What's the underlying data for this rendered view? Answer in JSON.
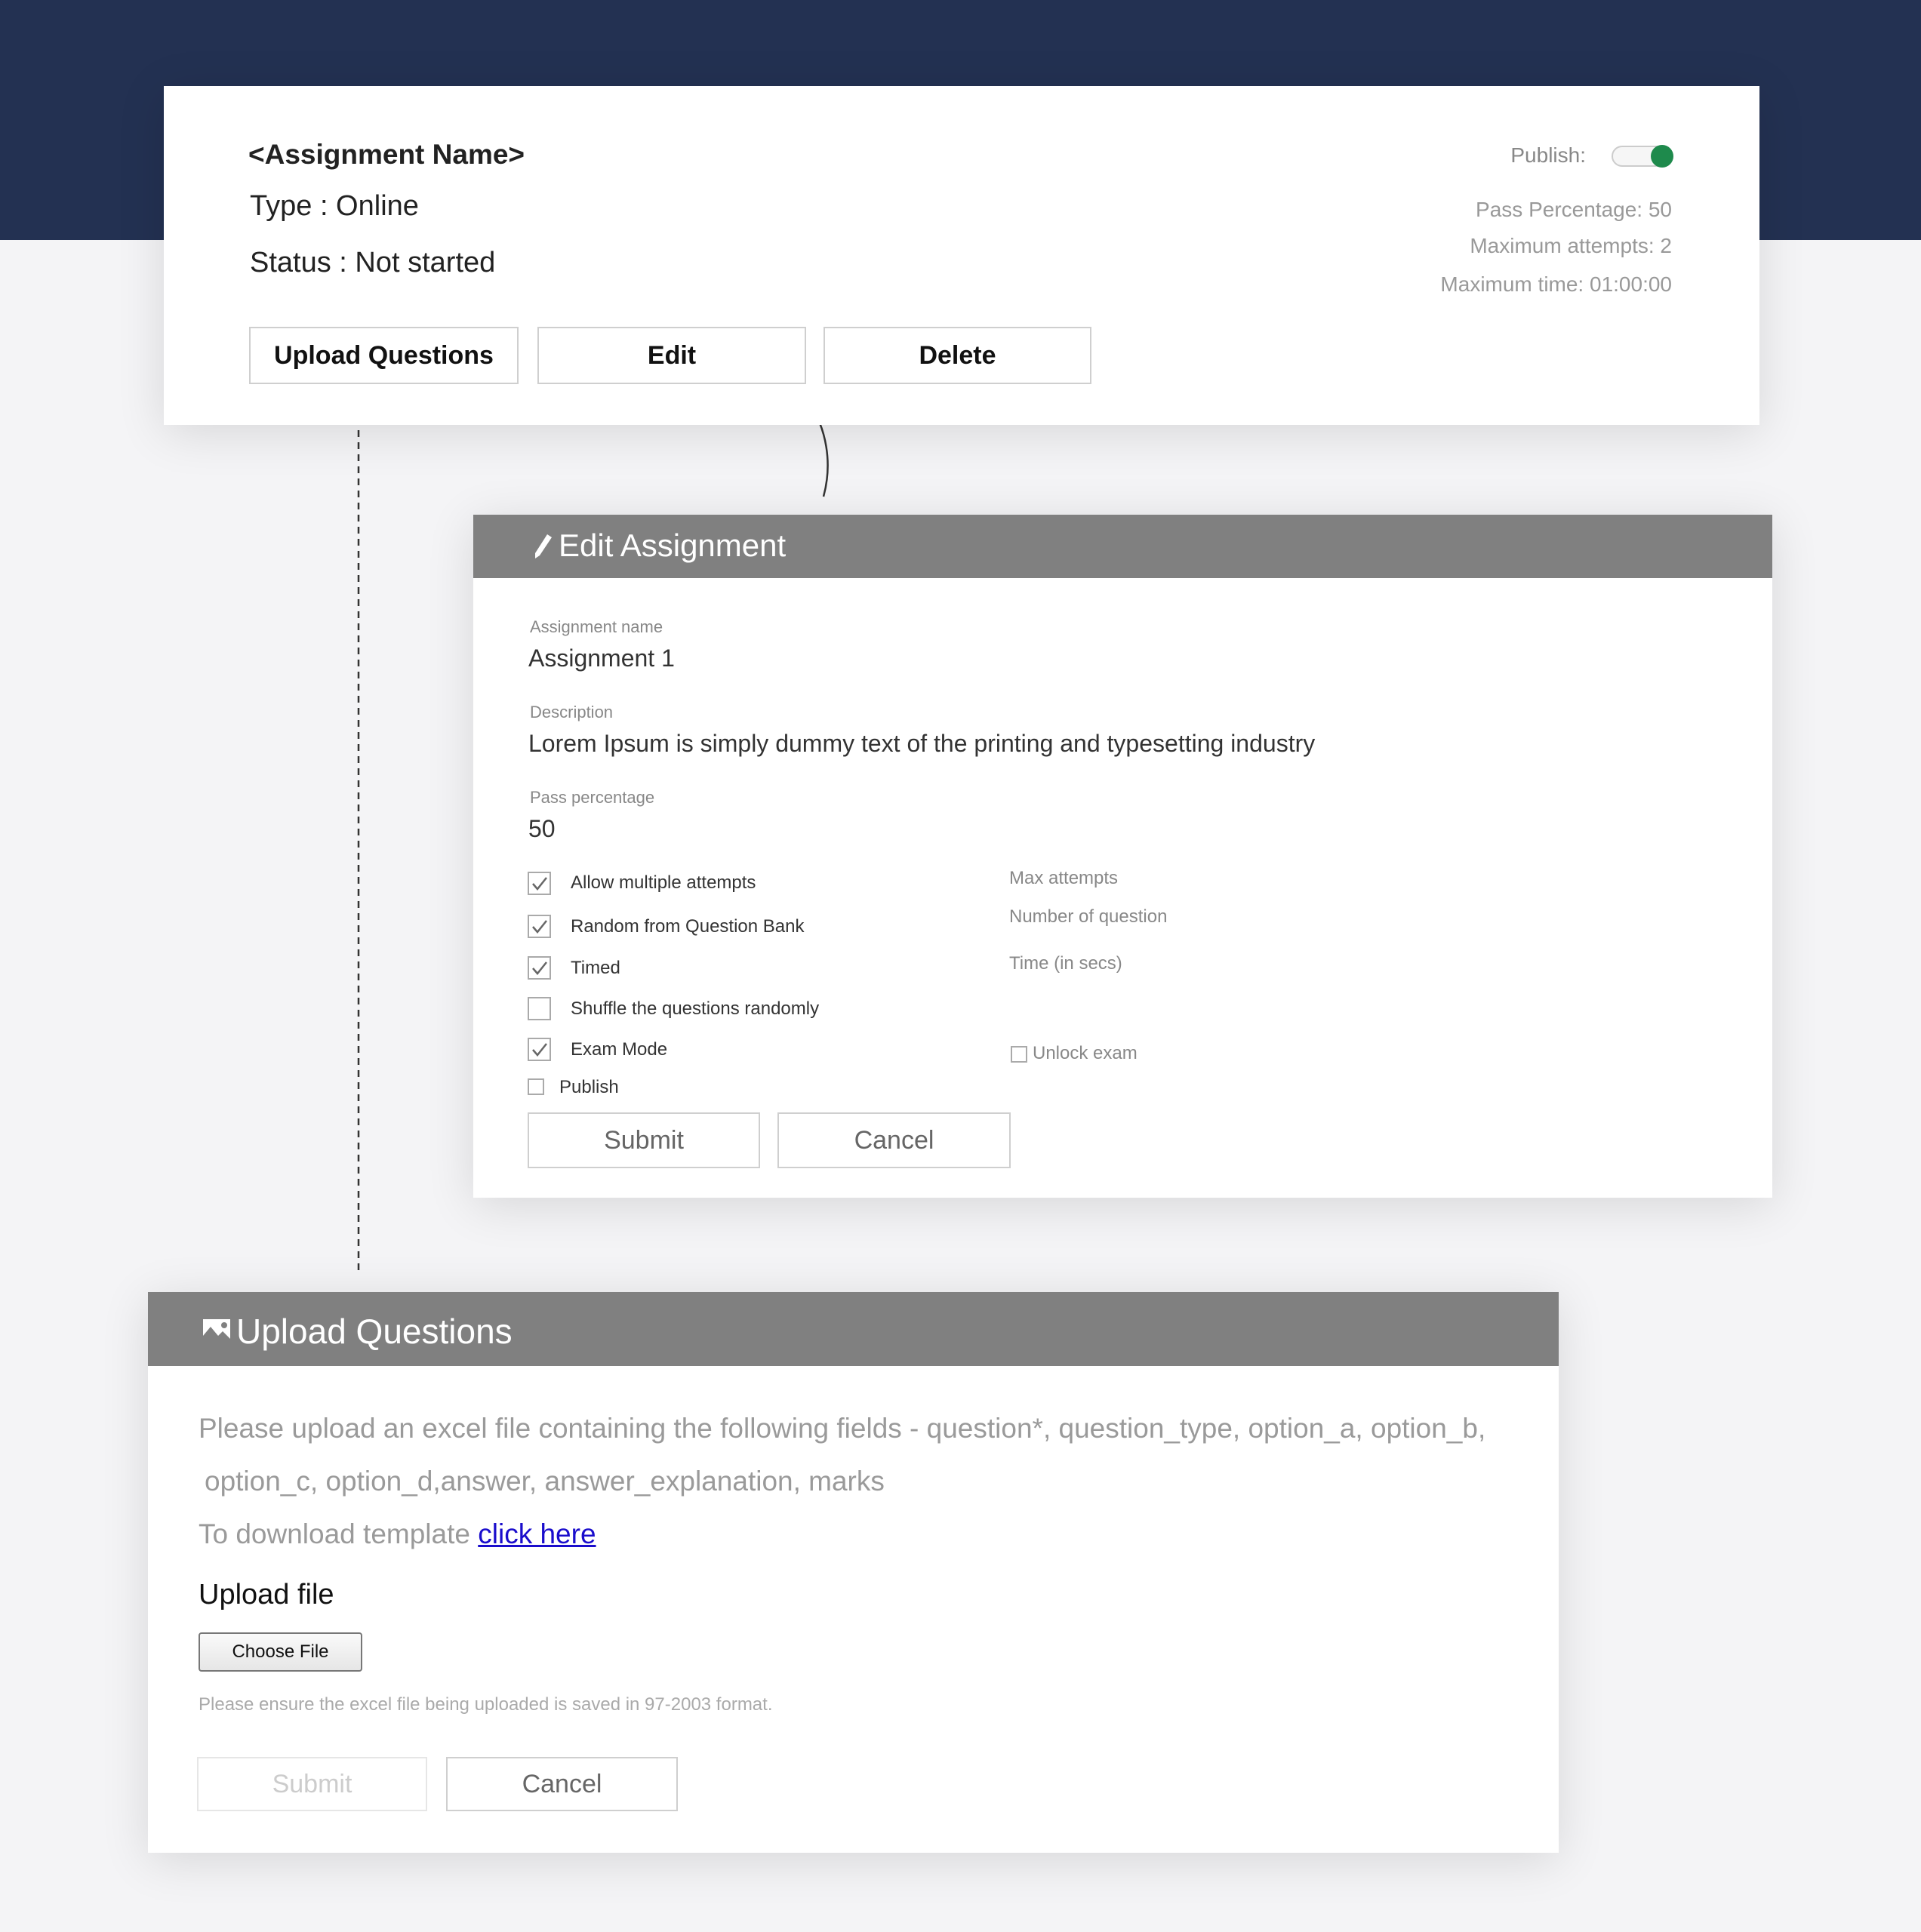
{
  "summary": {
    "title": "<Assignment Name>",
    "type": "Type : Online",
    "status": "Status : Not started",
    "publish_label": "Publish:",
    "publish_on": true,
    "pass_percentage": "Pass Percentage: 50",
    "max_attempts": "Maximum attempts: 2",
    "max_time": "Maximum time: 01:00:00",
    "buttons": {
      "upload": "Upload Questions",
      "edit": "Edit",
      "delete": "Delete"
    }
  },
  "edit_dialog": {
    "title": "Edit Assignment",
    "icon": "pencil-icon",
    "fields": {
      "name_label": "Assignment name",
      "name_value": "Assignment 1",
      "description_label": "Description",
      "description_value": "Lorem Ipsum is simply dummy text of the printing and typesetting industry",
      "pass_label": "Pass percentage",
      "pass_value": "50"
    },
    "options": [
      {
        "label": "Allow multiple attempts",
        "checked": true
      },
      {
        "label": "Random from Question Bank",
        "checked": true
      },
      {
        "label": "Timed",
        "checked": true
      },
      {
        "label": "Shuffle the questions randomly",
        "checked": false
      },
      {
        "label": "Exam Mode",
        "checked": true
      },
      {
        "label": "Publish",
        "checked": false
      }
    ],
    "side_fields": {
      "max_attempts": "Max attempts",
      "num_questions": "Number of question",
      "time": "Time (in secs)",
      "unlock_exam": "Unlock exam",
      "unlock_checked": false
    },
    "submit": "Submit",
    "cancel": "Cancel"
  },
  "upload_dialog": {
    "title": "Upload Questions",
    "icon": "image-icon",
    "instructions_line1": "Please upload an excel file containing the following fields - question*, question_type, option_a, option_b,",
    "instructions_line2": "option_c, option_d,answer, answer_explanation, marks",
    "template_text": "To download template ",
    "template_link": "click here",
    "upload_label": "Upload file",
    "choose_file": "Choose File",
    "note": "Please ensure the excel file being uploaded is saved in 97-2003 format.",
    "submit": "Submit",
    "cancel": "Cancel"
  },
  "colors": {
    "navy": "#233152",
    "header_gray": "#808080",
    "toggle_green": "#1e8a4c",
    "link": "#1a0dcc"
  }
}
